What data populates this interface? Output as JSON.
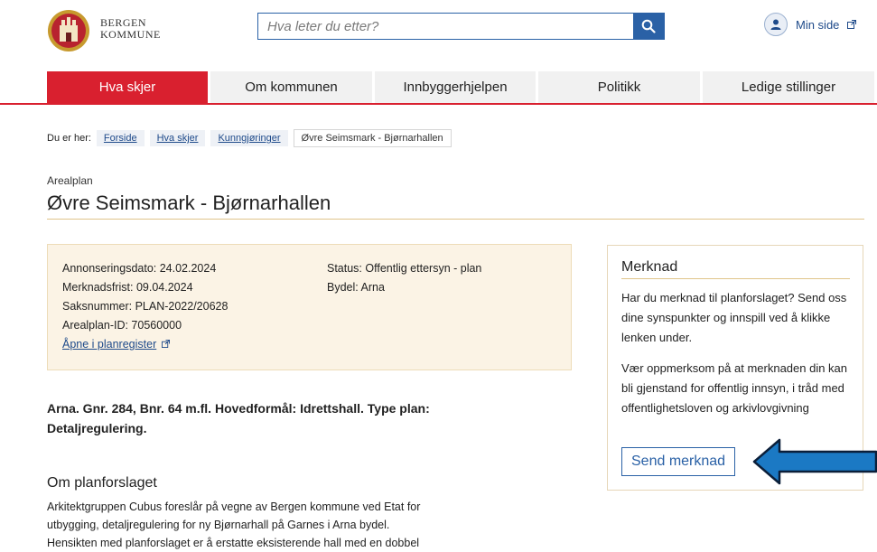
{
  "header": {
    "brand_line1": "BERGEN",
    "brand_line2": "KOMMUNE",
    "search_placeholder": "Hva leter du etter?",
    "min_side": "Min side"
  },
  "nav": {
    "tabs": [
      {
        "label": "Hva skjer",
        "active": true
      },
      {
        "label": "Om kommunen"
      },
      {
        "label": "Innbyggerhjelpen"
      },
      {
        "label": "Politikk"
      },
      {
        "label": "Ledige stillinger"
      }
    ]
  },
  "breadcrumb": {
    "prefix": "Du er her:",
    "items": [
      "Forside",
      "Hva skjer",
      "Kunngjøringer"
    ],
    "current": "Øvre Seimsmark - Bjørnarhallen"
  },
  "page": {
    "category": "Arealplan",
    "title": "Øvre Seimsmark - Bjørnarhallen"
  },
  "info": {
    "annonseringsdato": "Annonseringsdato: 24.02.2024",
    "merknadsfrist": "Merknadsfrist: 09.04.2024",
    "saksnummer": "Saksnummer: PLAN-2022/20628",
    "arealplan_id": "Arealplan-ID: 70560000",
    "link": "Åpne i planregister",
    "status": "Status: Offentlig ettersyn - plan",
    "bydel": "Bydel: Arna"
  },
  "summary": "Arna. Gnr. 284, Bnr. 64 m.fl. Hovedformål: Idrettshall. Type plan: Detaljregulering.",
  "section": {
    "heading": "Om planforslaget",
    "lines": [
      "Arkitektgruppen Cubus foreslår på vegne av Bergen kommune ved Etat for",
      "utbygging, detaljregulering for ny Bjørnarhall på Garnes i Arna bydel.",
      "Hensikten med planforslaget er å erstatte eksisterende hall med en dobbel"
    ]
  },
  "sidebar": {
    "title": "Merknad",
    "p1": "Har du merknad til planforslaget? Send oss dine synspunkter og innspill ved å klikke lenken under.",
    "p2": "Vær oppmerksom på at merknaden din kan bli gjenstand for offentlig innsyn, i tråd med offentlighetsloven og arkivlovgivning",
    "button": "Send merknad"
  },
  "colors": {
    "brand_red": "#d9202f",
    "link_blue": "#1e4a8a",
    "info_bg": "#fbf3e5",
    "arrow_blue": "#1b79c4"
  },
  "icons": {
    "search": "magnifier-icon",
    "user": "user-icon",
    "external": "external-link-icon",
    "annotation": "left-arrow-icon"
  }
}
